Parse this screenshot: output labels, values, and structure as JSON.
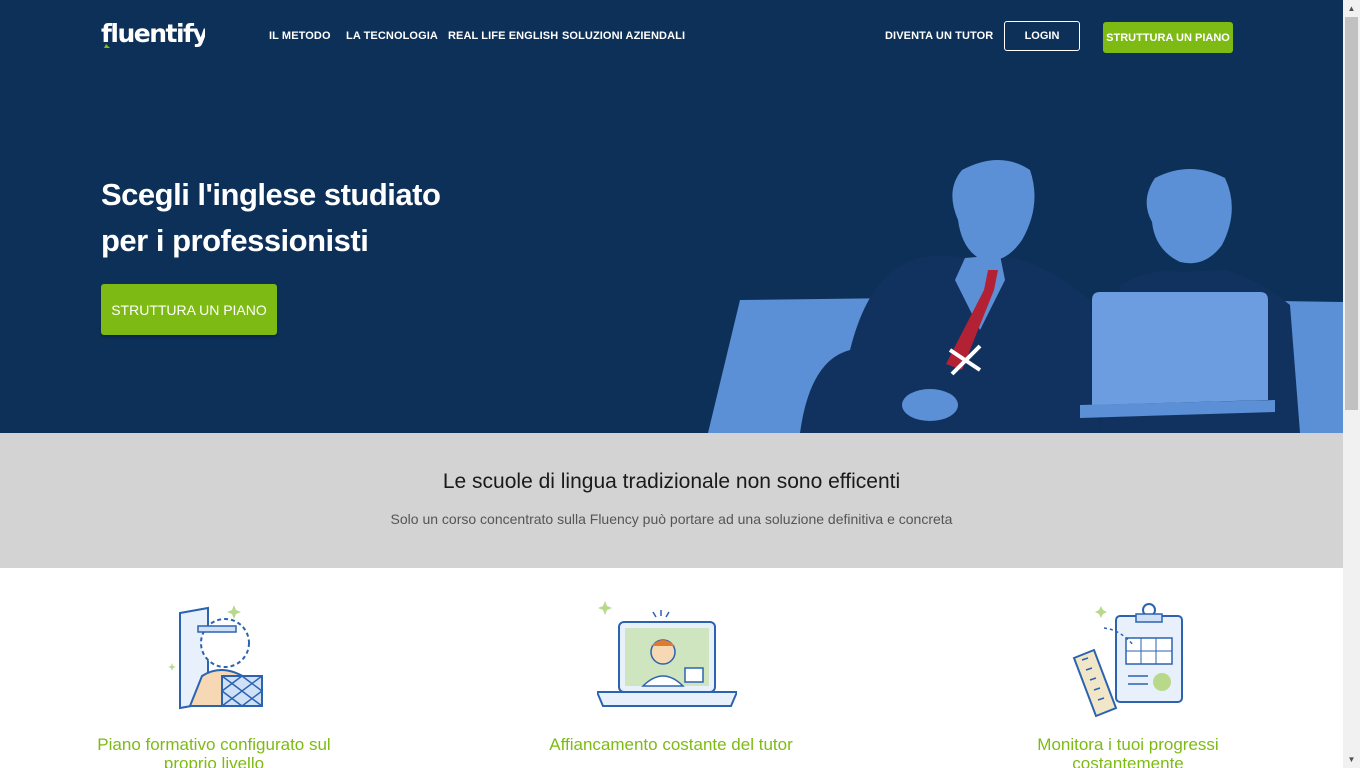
{
  "brand": {
    "logo_text": "fluentify"
  },
  "nav": {
    "links": [
      "IL METODO",
      "LA TECNOLOGIA",
      "REAL LIFE ENGLISH",
      "SOLUZIONI AZIENDALI"
    ],
    "tutor_link": "DIVENTA UN TUTOR",
    "login_label": "LOGIN",
    "cta_label": "STRUTTURA UN PIANO"
  },
  "hero": {
    "title_line1": "Scegli l'inglese studiato",
    "title_line2": "per i professionisti",
    "cta_label": "STRUTTURA UN PIANO"
  },
  "intro": {
    "title": "Le scuole di lingua tradizionale non sono efficenti",
    "subtitle": "Solo un corso concentrato sulla Fluency può portare ad una soluzione definitiva e concreta"
  },
  "features": [
    {
      "title": "Piano formativo configurato sul proprio livello"
    },
    {
      "title": "Affiancamento costante del tutor"
    },
    {
      "title": "Monitora i tuoi progressi costantemente"
    }
  ],
  "colors": {
    "navy": "#0d3059",
    "green": "#7dbb14",
    "band": "#d3d3d3",
    "art_blue": "#5b8fd6"
  },
  "icons": [
    "scrollbar-up-arrow-icon",
    "scrollbar-down-arrow-icon",
    "mirror-person-icon",
    "laptop-video-call-icon",
    "clipboard-ruler-icon"
  ]
}
